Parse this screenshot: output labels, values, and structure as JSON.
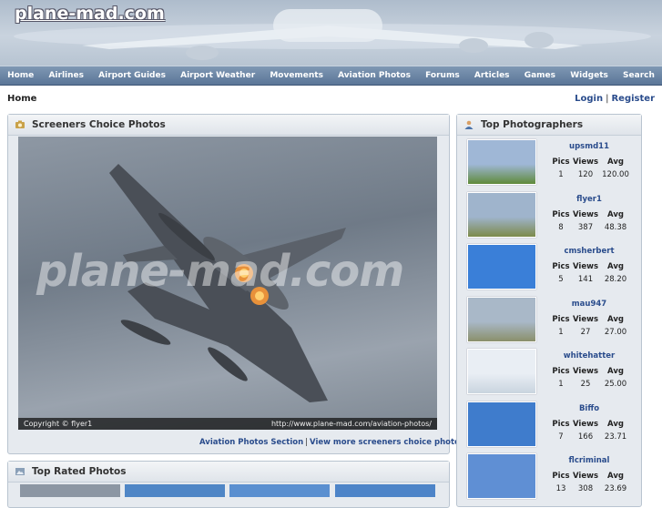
{
  "site": {
    "logo": "plane-mad.com"
  },
  "nav": [
    "Home",
    "Airlines",
    "Airport Guides",
    "Airport Weather",
    "Movements",
    "Aviation Photos",
    "Forums",
    "Articles",
    "Games",
    "Widgets",
    "Search"
  ],
  "breadcrumb": "Home",
  "auth": {
    "login": "Login",
    "separator": "|",
    "register": "Register"
  },
  "screeners": {
    "title": "Screeners Choice Photos",
    "watermark": "plane-mad.com",
    "copyright": "Copyright © flyer1",
    "url": "http://www.plane-mad.com/aviation-photos/",
    "link_section": "Aviation Photos Section",
    "link_separator": "|",
    "link_more": "View more screeners choice photos >>"
  },
  "top_rated": {
    "title": "Top Rated Photos"
  },
  "top_photographers": {
    "title": "Top Photographers",
    "headers": {
      "pics": "Pics",
      "views": "Views",
      "avg": "Avg"
    },
    "entries": [
      {
        "name": "upsmd11",
        "pics": "1",
        "views": "120",
        "avg": "120.00"
      },
      {
        "name": "flyer1",
        "pics": "8",
        "views": "387",
        "avg": "48.38"
      },
      {
        "name": "cmsherbert",
        "pics": "5",
        "views": "141",
        "avg": "28.20"
      },
      {
        "name": "mau947",
        "pics": "1",
        "views": "27",
        "avg": "27.00"
      },
      {
        "name": "whitehatter",
        "pics": "1",
        "views": "25",
        "avg": "25.00"
      },
      {
        "name": "Biffo",
        "pics": "7",
        "views": "166",
        "avg": "23.71"
      },
      {
        "name": "flcriminal",
        "pics": "13",
        "views": "308",
        "avg": "23.69"
      }
    ]
  },
  "colors": {
    "nav": "#5a7597",
    "link": "#2a4c8c",
    "panel": "#e6eaef"
  }
}
